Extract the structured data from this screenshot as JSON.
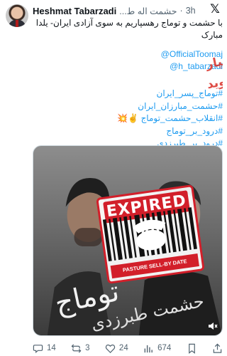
{
  "header": {
    "display_name": "Heshmat Tabarzadi",
    "handle": "حشمت اله ط...",
    "separator": "·",
    "time": "3h"
  },
  "body": {
    "text": "با حشمت و توماج رهسپاریم به سوی آزادی ایران- یلدا مبارک",
    "mention_1": "@OfficialToomaj",
    "mention_2": "@h_tabarzadi",
    "hashtag_1": "#توماج_پسر_ایران",
    "hashtag_2": "#حشمت_مبارزان_ایران",
    "hashtag_3": "#انقلاب_حشمت_توماج",
    "hashtag_3_emoji": "✌️💥",
    "hashtag_4": "#درود_بر_توماج",
    "hashtag_5": "#درود_بر_طبرزدی"
  },
  "overlay": {
    "line_1": "در کنار جمهوری اسلامی رهسپار",
    "line_2": "زباله دان تاریخ میشوید",
    "color": "#d7261e"
  },
  "media": {
    "stamp_top": "EXPIRED",
    "stamp_bottom": "PASTURE SELL-BY DATE",
    "title": "توماج",
    "subtitle": "حشمت طبرزدی",
    "mute_icon": "speaker-muted-icon"
  },
  "actions": {
    "replies": "14",
    "reposts": "3",
    "likes": "24",
    "views": "674"
  },
  "colors": {
    "link": "#1d9bf0",
    "muted": "#536471",
    "stamp_red": "#d21f2a"
  }
}
